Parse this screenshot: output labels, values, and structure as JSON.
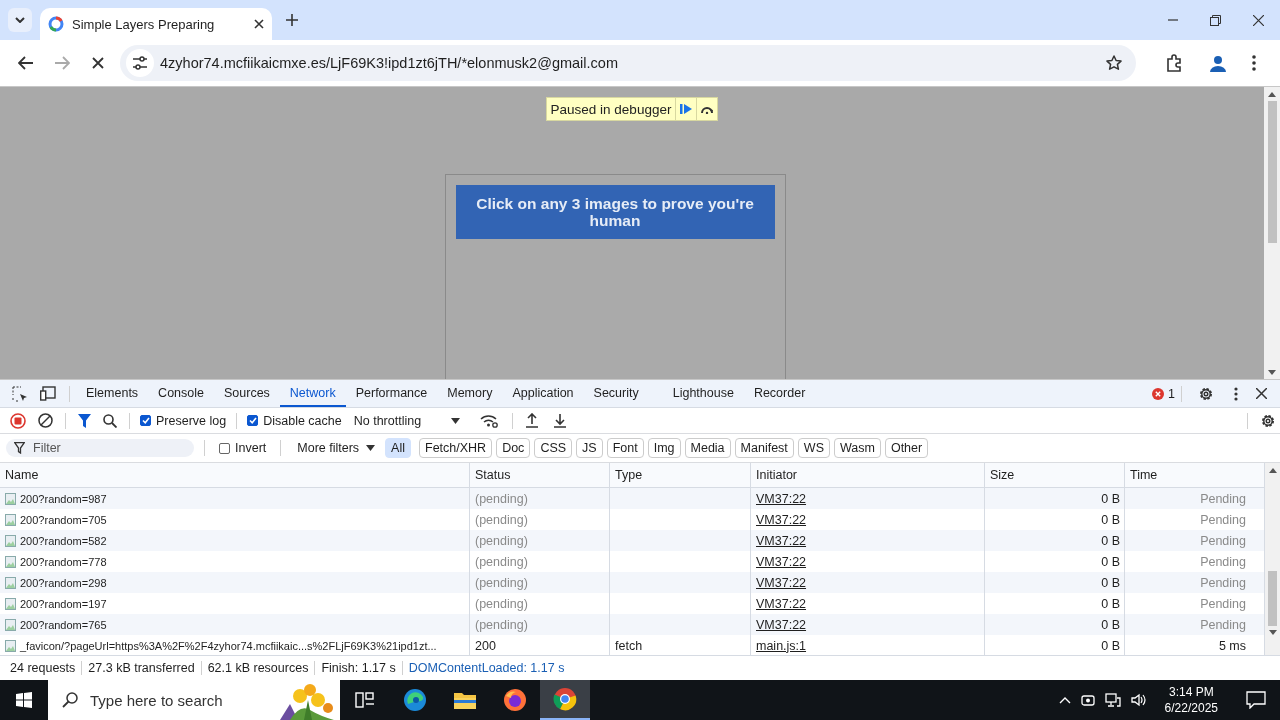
{
  "browser": {
    "tab_title": "Simple Layers Preparing",
    "url": "4zyhor74.mcfiikaicmxe.es/LjF69K3!ipd1zt6jTH/*elonmusk2@gmail.com"
  },
  "page": {
    "debugger_banner": "Paused in debugger",
    "captcha_prompt": "Click on any 3 images to prove you're human"
  },
  "devtools": {
    "tabs": [
      {
        "label": "Elements",
        "selected": false
      },
      {
        "label": "Console",
        "selected": false
      },
      {
        "label": "Sources",
        "selected": false
      },
      {
        "label": "Network",
        "selected": true
      },
      {
        "label": "Performance",
        "selected": false
      },
      {
        "label": "Memory",
        "selected": false
      },
      {
        "label": "Application",
        "selected": false
      },
      {
        "label": "Security",
        "selected": false
      },
      {
        "label": "Lighthouse",
        "selected": false
      },
      {
        "label": "Recorder",
        "selected": false
      }
    ],
    "error_count": "1",
    "preserve_log": {
      "label": "Preserve log",
      "checked": true
    },
    "disable_cache": {
      "label": "Disable cache",
      "checked": true
    },
    "throttling": "No throttling",
    "filter": {
      "placeholder": "Filter"
    },
    "invert": {
      "label": "Invert",
      "checked": false
    },
    "more_filters": "More filters",
    "type_filters": [
      {
        "label": "All",
        "selected": true
      },
      {
        "label": "Fetch/XHR",
        "selected": false
      },
      {
        "label": "Doc",
        "selected": false
      },
      {
        "label": "CSS",
        "selected": false
      },
      {
        "label": "JS",
        "selected": false
      },
      {
        "label": "Font",
        "selected": false
      },
      {
        "label": "Img",
        "selected": false
      },
      {
        "label": "Media",
        "selected": false
      },
      {
        "label": "Manifest",
        "selected": false
      },
      {
        "label": "WS",
        "selected": false
      },
      {
        "label": "Wasm",
        "selected": false
      },
      {
        "label": "Other",
        "selected": false
      }
    ],
    "columns": [
      "Name",
      "Status",
      "Type",
      "Initiator",
      "Size",
      "Time"
    ],
    "rows": [
      {
        "name": "200?random=987",
        "status": "(pending)",
        "type": "",
        "initiator": "VM37:22",
        "size": "0 B",
        "time": "Pending",
        "pending": true
      },
      {
        "name": "200?random=705",
        "status": "(pending)",
        "type": "",
        "initiator": "VM37:22",
        "size": "0 B",
        "time": "Pending",
        "pending": true
      },
      {
        "name": "200?random=582",
        "status": "(pending)",
        "type": "",
        "initiator": "VM37:22",
        "size": "0 B",
        "time": "Pending",
        "pending": true
      },
      {
        "name": "200?random=778",
        "status": "(pending)",
        "type": "",
        "initiator": "VM37:22",
        "size": "0 B",
        "time": "Pending",
        "pending": true
      },
      {
        "name": "200?random=298",
        "status": "(pending)",
        "type": "",
        "initiator": "VM37:22",
        "size": "0 B",
        "time": "Pending",
        "pending": true
      },
      {
        "name": "200?random=197",
        "status": "(pending)",
        "type": "",
        "initiator": "VM37:22",
        "size": "0 B",
        "time": "Pending",
        "pending": true
      },
      {
        "name": "200?random=765",
        "status": "(pending)",
        "type": "",
        "initiator": "VM37:22",
        "size": "0 B",
        "time": "Pending",
        "pending": true
      },
      {
        "name": "_favicon/?pageUrl=https%3A%2F%2F4zyhor74.mcfiikaic...s%2FLjF69K3%21ipd1zt...",
        "status": "200",
        "type": "fetch",
        "initiator": "main.js:1",
        "size": "0 B",
        "time": "5 ms",
        "pending": false
      }
    ],
    "summary": [
      {
        "text": "24 requests",
        "kind": "text"
      },
      {
        "text": "27.3 kB transferred",
        "kind": "text"
      },
      {
        "text": "62.1 kB resources",
        "kind": "text"
      },
      {
        "text": "Finish: 1.17 s",
        "kind": "text"
      },
      {
        "text": "DOMContentLoaded: 1.17 s",
        "kind": "link"
      }
    ]
  },
  "taskbar": {
    "search_placeholder": "Type here to search",
    "apps": [
      {
        "kind": "taskview",
        "selected": false
      },
      {
        "kind": "edge",
        "selected": false
      },
      {
        "kind": "explorer",
        "selected": false
      },
      {
        "kind": "firefox",
        "selected": false
      },
      {
        "kind": "chrome",
        "selected": true
      }
    ],
    "time": "3:14 PM",
    "date": "6/22/2025"
  }
}
